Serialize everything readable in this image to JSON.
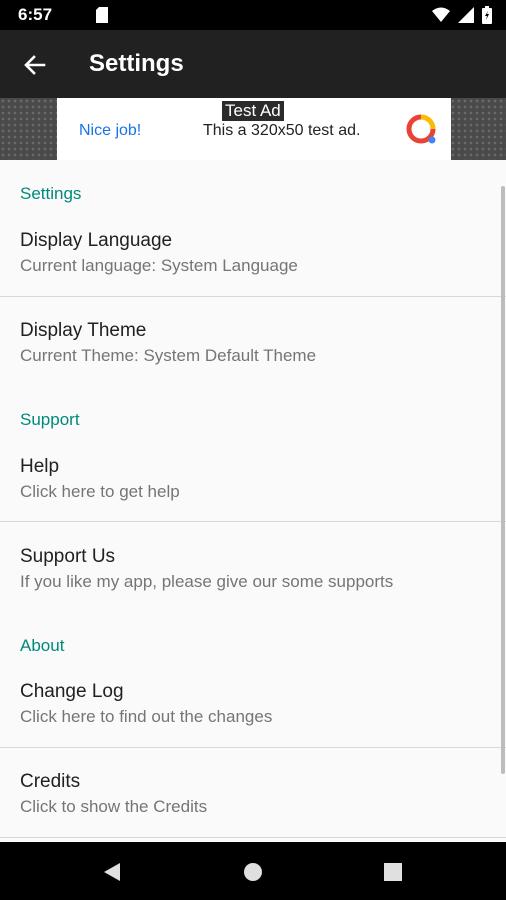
{
  "status_bar": {
    "time": "6:57"
  },
  "app_bar": {
    "title": "Settings"
  },
  "ad": {
    "tag": "Test Ad",
    "nice_job": "Nice job!",
    "text": "This a 320x50 test ad."
  },
  "sections": [
    {
      "header": "Settings",
      "items": [
        {
          "title": "Display Language",
          "summary": "Current language: System Language"
        },
        {
          "title": "Display Theme",
          "summary": "Current Theme: System Default Theme"
        }
      ]
    },
    {
      "header": "Support",
      "items": [
        {
          "title": "Help",
          "summary": "Click here to get help"
        },
        {
          "title": "Support Us",
          "summary": "If you like my app, please give our some supports"
        }
      ]
    },
    {
      "header": "About",
      "items": [
        {
          "title": "Change Log",
          "summary": "Click here to find out the changes"
        },
        {
          "title": "Credits",
          "summary": "Click to show the Credits"
        }
      ]
    }
  ],
  "colors": {
    "accent": "#00897b",
    "app_bar": "#212121",
    "background": "#fafafa"
  },
  "icons": [
    "sd-card-icon",
    "wifi-icon",
    "signal-icon",
    "battery-icon",
    "back-arrow-icon",
    "nav-back-icon",
    "nav-home-icon",
    "nav-recents-icon"
  ]
}
